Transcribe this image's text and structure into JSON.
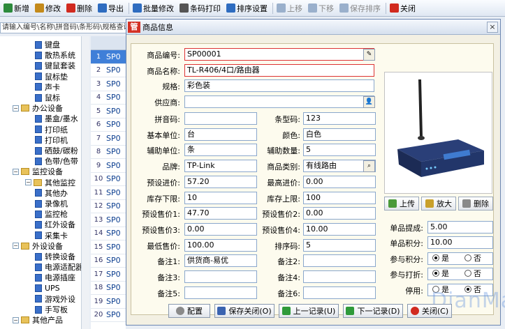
{
  "toolbar": {
    "items": [
      {
        "label": "新增",
        "icon": "plus-icon",
        "color": "#2c8a3c"
      },
      {
        "label": "修改",
        "icon": "edit-icon",
        "color": "#c48a1a"
      },
      {
        "label": "删除",
        "icon": "delete-icon",
        "color": "#d12a1f"
      },
      {
        "label": "导出",
        "icon": "export-icon",
        "color": "#2e6cc0"
      },
      {
        "label": "批量修改",
        "icon": "batch-edit-icon",
        "color": "#2e6cc0"
      },
      {
        "label": "条码打印",
        "icon": "barcode-print-icon",
        "color": "#555"
      },
      {
        "label": "排序设置",
        "icon": "sort-settings-icon",
        "color": "#2e6cc0"
      },
      {
        "label": "上移",
        "icon": "move-up-icon",
        "color": "#9ab0cc"
      },
      {
        "label": "下移",
        "icon": "move-down-icon",
        "color": "#9ab0cc"
      },
      {
        "label": "保存排序",
        "icon": "save-sort-icon",
        "color": "#9ab0cc"
      },
      {
        "label": "关闭",
        "icon": "close-icon",
        "color": "#d12a1f"
      }
    ]
  },
  "search": {
    "text": "请输入编号\\名称\\拼音码\\条形码\\规格查询"
  },
  "tree": {
    "items": [
      {
        "label": "键盘",
        "level": 3
      },
      {
        "label": "散热系统",
        "level": 3
      },
      {
        "label": "键鼠套装",
        "level": 3
      },
      {
        "label": "鼠标垫",
        "level": 3
      },
      {
        "label": "声卡",
        "level": 3
      },
      {
        "label": "鼠标",
        "level": 3
      },
      {
        "label": "办公设备",
        "level": 1
      },
      {
        "label": "墨盒/墨水",
        "level": 3
      },
      {
        "label": "打印纸",
        "level": 3
      },
      {
        "label": "打印机",
        "level": 3
      },
      {
        "label": "硒鼓/碳粉",
        "level": 3
      },
      {
        "label": "色带/色带",
        "level": 3
      },
      {
        "label": "监控设备",
        "level": 1
      },
      {
        "label": "其他监控",
        "level": 2
      },
      {
        "label": "其他办",
        "level": 3
      },
      {
        "label": "录像机",
        "level": 3
      },
      {
        "label": "监控枪",
        "level": 3
      },
      {
        "label": "红外设备",
        "level": 3
      },
      {
        "label": "采集卡",
        "level": 3
      },
      {
        "label": "外设设备",
        "level": 1
      },
      {
        "label": "转换设备",
        "level": 3
      },
      {
        "label": "电源适配器",
        "level": 3
      },
      {
        "label": "电源插座",
        "level": 3
      },
      {
        "label": "UPS",
        "level": 3
      },
      {
        "label": "游戏外设",
        "level": 3
      },
      {
        "label": "手写板",
        "level": 3
      },
      {
        "label": "其他产品",
        "level": 1
      }
    ]
  },
  "grid": {
    "rows": [
      {
        "num": "1",
        "code": "SP0"
      },
      {
        "num": "2",
        "code": "SP0"
      },
      {
        "num": "3",
        "code": "SP0"
      },
      {
        "num": "4",
        "code": "SP0"
      },
      {
        "num": "5",
        "code": "SP0"
      },
      {
        "num": "6",
        "code": "SP0"
      },
      {
        "num": "7",
        "code": "SP0"
      },
      {
        "num": "8",
        "code": "SP0"
      },
      {
        "num": "9",
        "code": "SP0"
      },
      {
        "num": "10",
        "code": "SP0"
      },
      {
        "num": "11",
        "code": "SP0"
      },
      {
        "num": "12",
        "code": "SP0"
      },
      {
        "num": "13",
        "code": "SP0"
      },
      {
        "num": "14",
        "code": "SP0"
      },
      {
        "num": "15",
        "code": "SP0"
      },
      {
        "num": "16",
        "code": "SP0"
      },
      {
        "num": "17",
        "code": "SP0"
      },
      {
        "num": "18",
        "code": "SP0"
      },
      {
        "num": "19",
        "code": "SP0"
      },
      {
        "num": "20",
        "code": "SP0"
      }
    ]
  },
  "dialog": {
    "title": "商品信息",
    "logo": "管",
    "close": "×",
    "fields": {
      "code_label": "商品编号:",
      "code": "SP00001",
      "name_label": "商品名称:",
      "name": "TL-R406/4口/路由器",
      "spec_label": "规格:",
      "spec": "彩色装",
      "supplier_label": "供应商:",
      "supplier": "",
      "pinyin_label": "拼音码:",
      "pinyin": "",
      "barcode_label": "条型码:",
      "barcode": "123",
      "unit_label": "基本单位:",
      "unit": "台",
      "color_label": "颜色:",
      "color": "白色",
      "aux_unit_label": "辅助单位:",
      "aux_unit": "条",
      "aux_qty_label": "辅助数量:",
      "aux_qty": "5",
      "brand_label": "品牌:",
      "brand": "TP-Link",
      "category_label": "商品类别:",
      "category": "有线路由",
      "preset_buy_label": "预设进价:",
      "preset_buy": "57.20",
      "max_buy_label": "最高进价:",
      "max_buy": "0.00",
      "stock_min_label": "库存下限:",
      "stock_min": "10",
      "stock_max_label": "库存上限:",
      "stock_max": "100",
      "price1_label": "预设售价1:",
      "price1": "47.70",
      "price2_label": "预设售价2:",
      "price2": "0.00",
      "price3_label": "预设售价3:",
      "price3": "0.00",
      "price4_label": "预设售价4:",
      "price4": "10.00",
      "min_price_label": "最低售价:",
      "min_price": "100.00",
      "sort_label": "排序码:",
      "sort": "5",
      "note1_label": "备注1:",
      "note1": "供货商-易优",
      "note2_label": "备注2:",
      "note2": "",
      "note3_label": "备注3:",
      "note3": "",
      "note4_label": "备注4:",
      "note4": "",
      "note5_label": "备注5:",
      "note5": "",
      "note6_label": "备注6:",
      "note6": "",
      "commission_label": "单品提成:",
      "commission": "5.00",
      "points_label": "单品积分:",
      "points": "10.00",
      "join_points_label": "参与积分:",
      "join_discount_label": "参与打折:",
      "disabled_label": "停用:",
      "yes": "是",
      "no": "否"
    },
    "photo_buttons": {
      "upload": "上传",
      "zoom": "放大",
      "delete": "删除"
    },
    "buttons": {
      "config": "配置",
      "save_close": "保存关闭(O)",
      "prev": "上一记录(U)",
      "next": "下一记录(D)",
      "close": "关闭(C)"
    },
    "watermark": "DianMai 点迈"
  }
}
